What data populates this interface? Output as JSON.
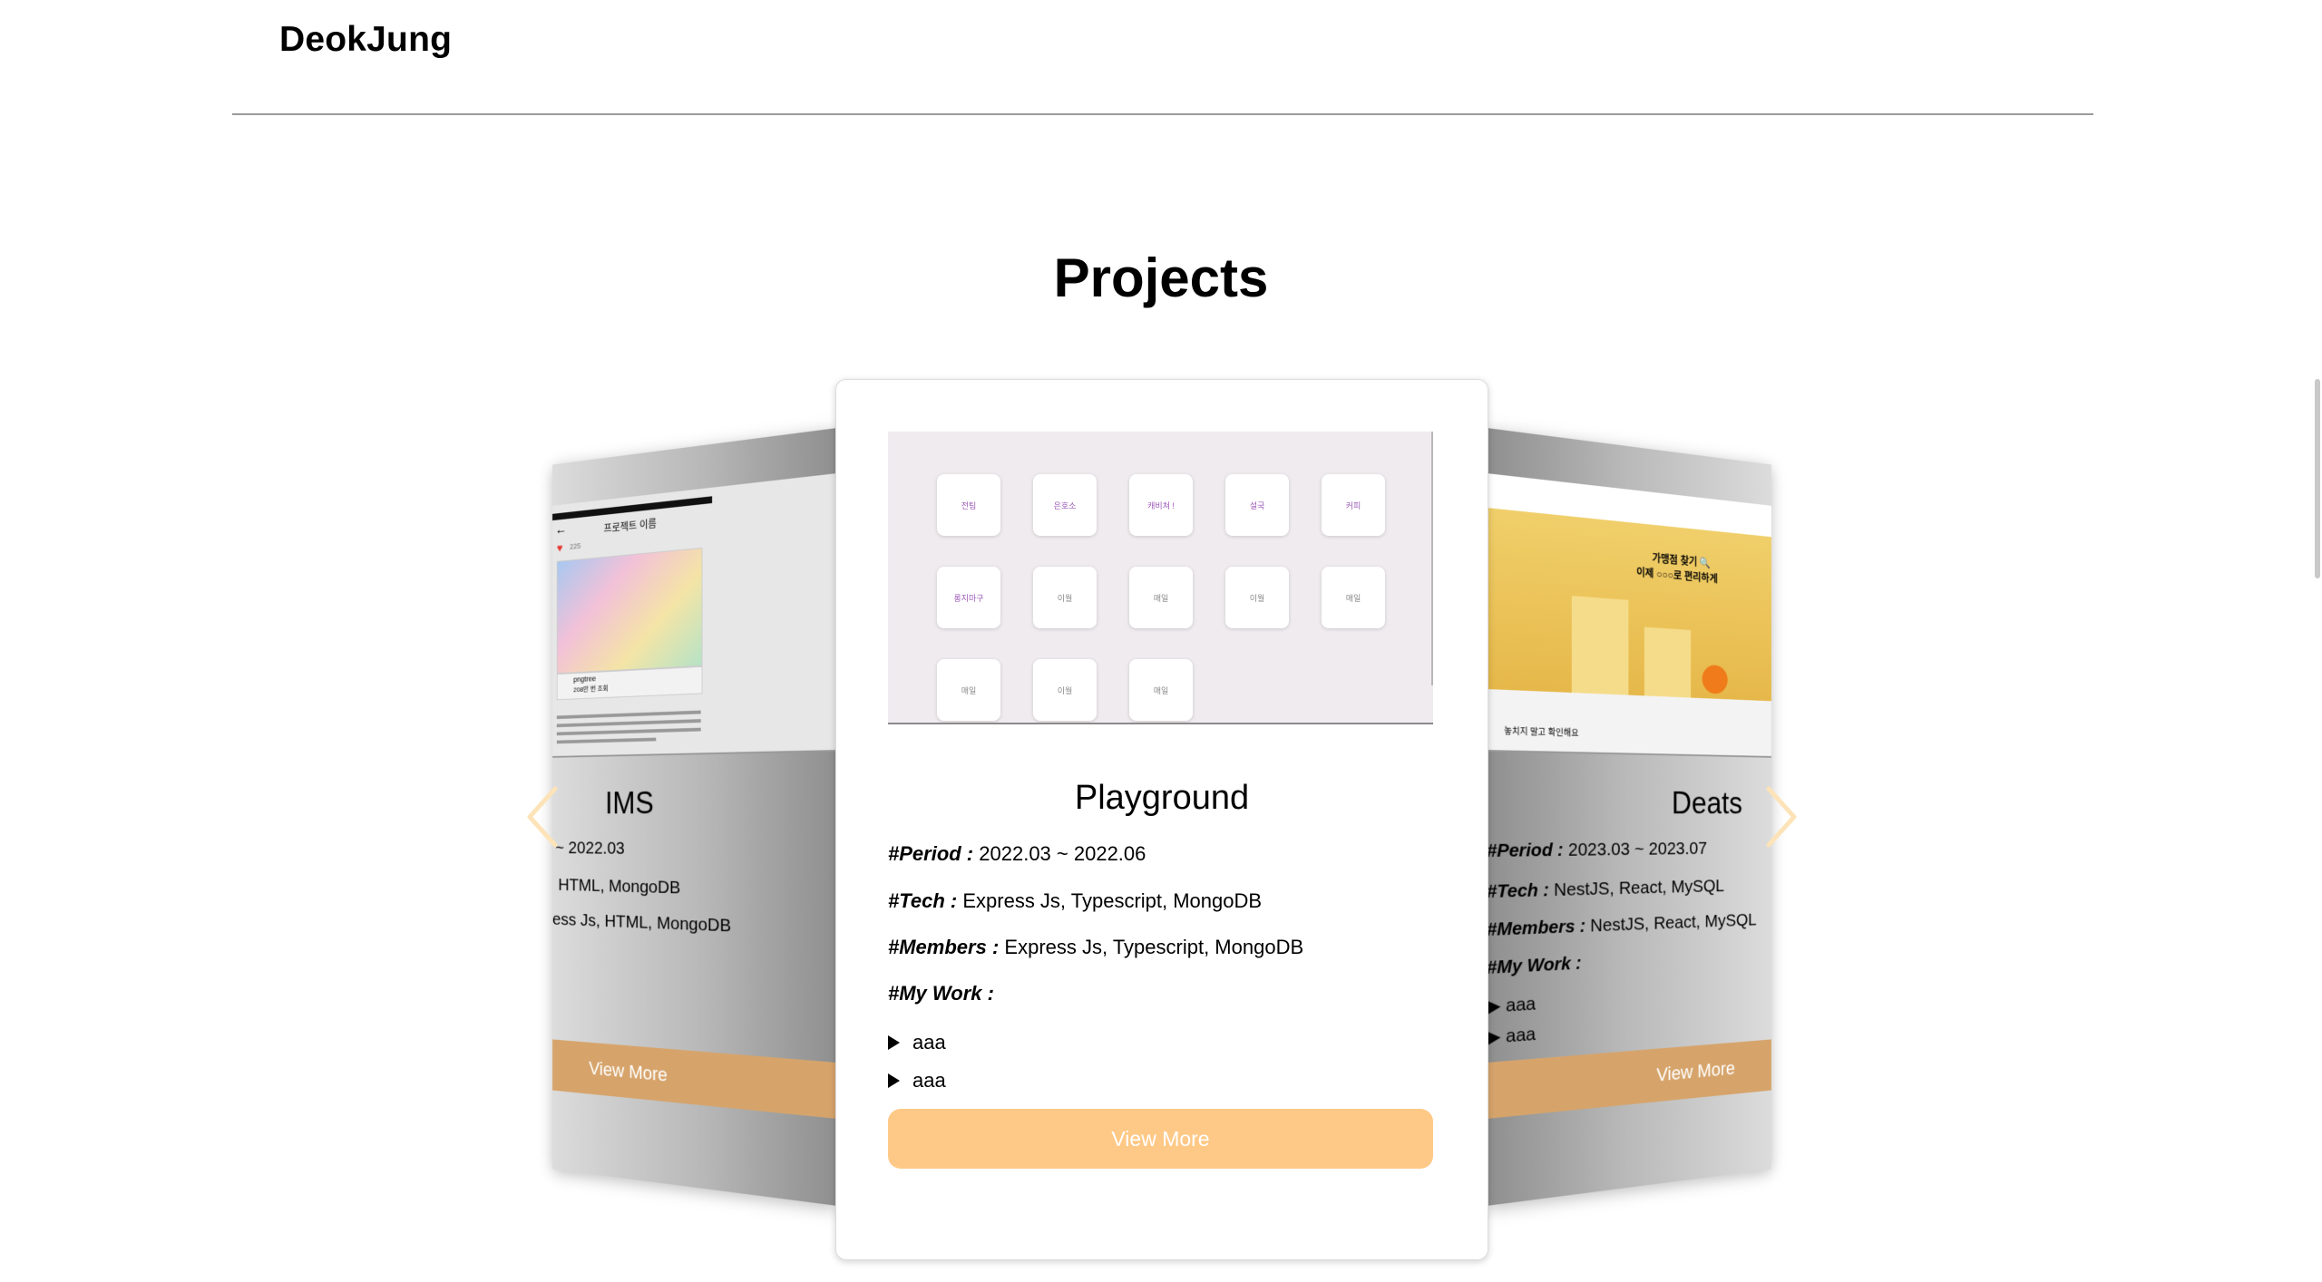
{
  "header": {
    "title": "DeokJung"
  },
  "section": {
    "title": "Projects"
  },
  "carousel": {
    "left": {
      "name": "IMS",
      "period": "~ 2022.03",
      "tech": "HTML, MongoDB",
      "members": "ess Js, HTML, MongoDB",
      "view_more": "View More",
      "thumb": {
        "app_title": "프로젝트 이름",
        "likes": "225",
        "brand": "pngtree",
        "stat": "208만 번 조회"
      }
    },
    "center": {
      "name": "Playground",
      "period_label": "#Period :",
      "period": "2022.03 ~ 2022.06",
      "tech_label": "#Tech :",
      "tech": "Express Js, Typescript, MongoDB",
      "members_label": "#Members :",
      "members": "Express Js, Typescript, MongoDB",
      "work_label": "#My Work :",
      "work_items": [
        "aaa",
        "aaa"
      ],
      "view_more": "View More",
      "tiles": [
        "전팀",
        "은호소",
        "캐비쳐 !",
        "설국",
        "커피",
        "롱지마구",
        "이월",
        "매일",
        "이월",
        "매일",
        "매일",
        "이월",
        "매일"
      ]
    },
    "right": {
      "name": "Deats",
      "period_label": "#Period :",
      "period": "2023.03 ~ 2023.07",
      "tech_label": "#Tech :",
      "tech": "NestJS, React, MySQL",
      "members_label": "#Members :",
      "members": "NestJS, React, MySQL",
      "work_label": "#My Work :",
      "work_items": [
        "aaa",
        "aaa"
      ],
      "view_more": "View More",
      "thumb": {
        "headline_1": "가맹점 찾기 🔍",
        "headline_2": "이제 ○○○로 편리하게",
        "footer_text": "놓치지 말고 확인해요"
      }
    }
  },
  "colors": {
    "accent": "#fec987",
    "side_button": "#d6a46b",
    "tile_text": "#9b59b6"
  }
}
